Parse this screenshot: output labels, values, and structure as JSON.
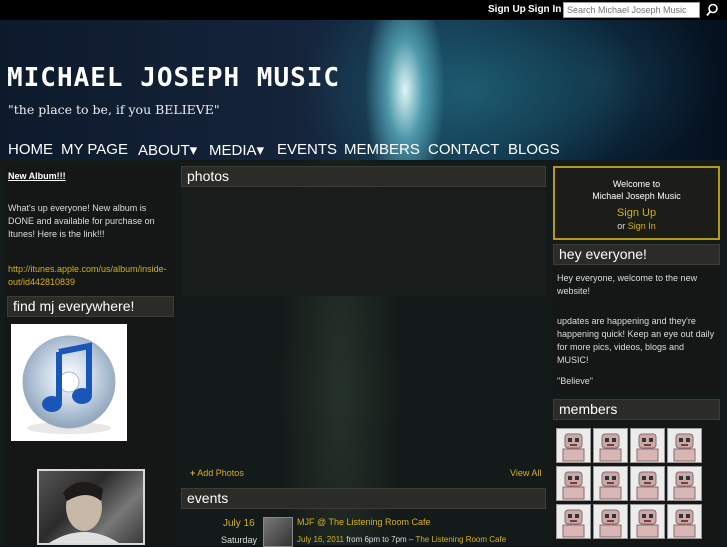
{
  "topbar": {
    "signup": "Sign Up",
    "signin": "Sign In",
    "search_placeholder": "Search Michael Joseph Music"
  },
  "site": {
    "title": "MICHAEL JOSEPH MUSIC",
    "tagline": "\"the place to be, if you BELIEVE\""
  },
  "nav": [
    "HOME",
    "MY PAGE",
    "ABOUT▾",
    "MEDIA▾",
    "EVENTS",
    "MEMBERS",
    "CONTACT",
    "BLOGS"
  ],
  "left": {
    "post_title": "New Album!!!",
    "post_body": "What's up everyone! New album is DONE and available for purchase on Itunes! Here is the link!!!",
    "post_link_1": "http://itunes.apple.com/us/album/inside-",
    "post_link_2": "out/id442810839",
    "find_header": "find mj everywhere!"
  },
  "photos": {
    "header": "photos",
    "add": "Add Photos",
    "view_all": "View All"
  },
  "events": {
    "header": "events",
    "date": "July 16",
    "day": "Saturday",
    "title": "MJF @ The Listening Room Cafe",
    "when": "July 16, 2011",
    "time": "from 6pm to 7pm –",
    "venue": "The Listening Room Cafe"
  },
  "right": {
    "welcome_1": "Welcome to",
    "welcome_2": "Michael Joseph Music",
    "signup": "Sign Up",
    "or": "or",
    "signin": "Sign In",
    "hey_header": "hey everyone!",
    "hey_p1": "Hey everyone, welcome to the new website!",
    "hey_p2": "updates are happening and they're happening quick! Keep an eye out daily for more pics, videos, blogs and MUSIC!",
    "hey_p3": "\"Believe\"",
    "members_header": "members"
  },
  "colors": {
    "accent": "#d4b21a",
    "border": "#b29a1b"
  }
}
